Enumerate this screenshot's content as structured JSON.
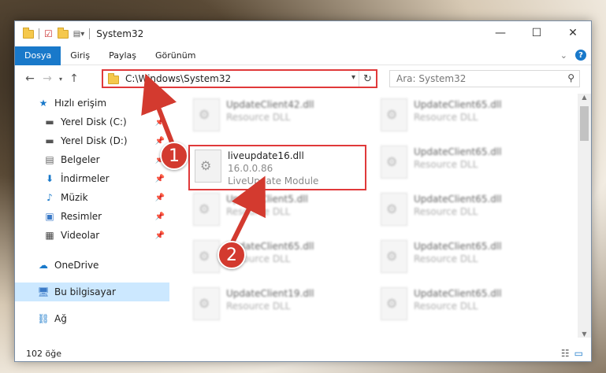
{
  "window": {
    "title": "System32"
  },
  "ribbon": {
    "tabs": [
      "Dosya",
      "Giriş",
      "Paylaş",
      "Görünüm"
    ],
    "help_label": "?"
  },
  "address": {
    "path": "C:\\Windows\\System32",
    "search_placeholder": "Ara: System32"
  },
  "nav": {
    "items": [
      {
        "label": "Hızlı erişim",
        "icon": "star-icon"
      },
      {
        "label": "Yerel Disk (C:)",
        "icon": "drive-icon"
      },
      {
        "label": "Yerel Disk (D:)",
        "icon": "drive-icon"
      },
      {
        "label": "Belgeler",
        "icon": "document-icon"
      },
      {
        "label": "İndirmeler",
        "icon": "download-icon"
      },
      {
        "label": "Müzik",
        "icon": "music-icon"
      },
      {
        "label": "Resimler",
        "icon": "pictures-icon"
      },
      {
        "label": "Videolar",
        "icon": "video-icon"
      },
      {
        "label": "OneDrive",
        "icon": "cloud-icon"
      },
      {
        "label": "Bu bilgisayar",
        "icon": "computer-icon"
      },
      {
        "label": "Ağ",
        "icon": "network-icon"
      }
    ]
  },
  "files": [
    {
      "name": "UpdateClient42.dll",
      "desc": "Resource DLL"
    },
    {
      "name": "UpdateClient65.dll",
      "desc": "Resource DLL"
    },
    {
      "name": "liveupdate16.dll",
      "version": "16.0.0.86",
      "desc": "LiveUpdate Module"
    },
    {
      "name": "UpdateClient65.dll",
      "desc": "Resource DLL"
    },
    {
      "name": "UpdateClient5.dll",
      "desc": "Resource DLL"
    },
    {
      "name": "UpdateClient65.dll",
      "desc": "Resource DLL"
    },
    {
      "name": "UpdateClient65.dll",
      "desc": "Resource DLL"
    },
    {
      "name": "UpdateClient65.dll",
      "desc": "Resource DLL"
    },
    {
      "name": "UpdateClient19.dll",
      "desc": "Resource DLL"
    },
    {
      "name": "UpdateClient65.dll",
      "desc": "Resource DLL"
    }
  ],
  "status": {
    "count": "102 öğe"
  },
  "callouts": [
    "1",
    "2"
  ],
  "colors": {
    "accent": "#1979ca",
    "highlight": "#e0393a",
    "callout": "#d33a2f",
    "selection": "#cce8ff"
  }
}
